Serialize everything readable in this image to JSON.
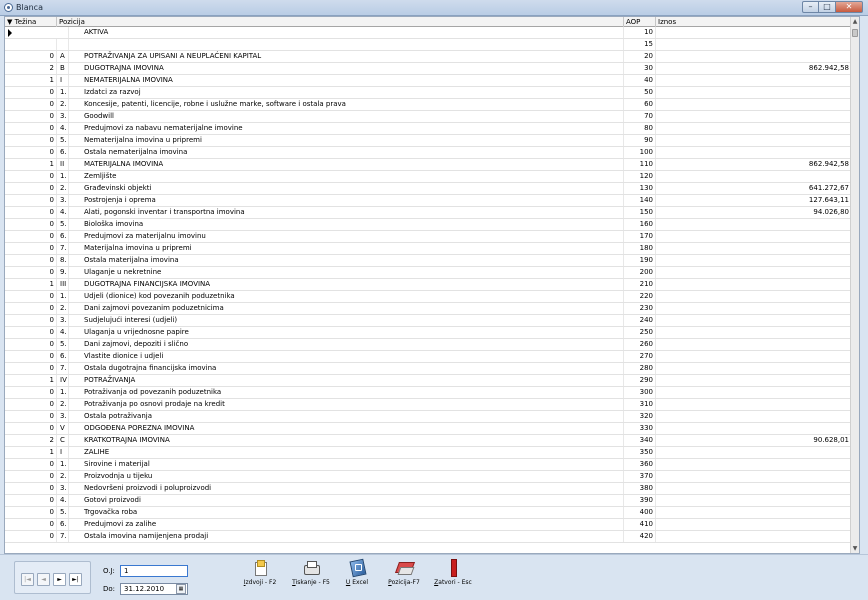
{
  "window": {
    "title": "Blanca",
    "minimize": "–",
    "maximize": "□",
    "close": "✕"
  },
  "grid": {
    "columns": {
      "tezina": "▼ Težina",
      "pozicija": "Pozicija",
      "aop": "AOP",
      "iznos": "Iznos"
    },
    "rows": [
      {
        "tez": "",
        "oz": "",
        "poz": "",
        "txt": "AKTIVA",
        "aop": "10",
        "iz": ""
      },
      {
        "tez": "",
        "oz": "",
        "poz": "",
        "txt": "",
        "aop": "15",
        "iz": ""
      },
      {
        "tez": "0",
        "oz": "A",
        "poz": "",
        "txt": "POTRAŽIVANJA ZA UPISANI A NEUPLAĆENI KAPITAL",
        "aop": "20",
        "iz": ""
      },
      {
        "tez": "2",
        "oz": "B",
        "poz": "",
        "txt": "DUGOTRAJNA IMOVINA",
        "aop": "30",
        "iz": "862.942,58"
      },
      {
        "tez": "1",
        "oz": "I",
        "poz": "",
        "txt": "NEMATERIJALNA IMOVINA",
        "aop": "40",
        "iz": ""
      },
      {
        "tez": "0",
        "oz": "1.",
        "poz": "",
        "txt": "Izdatci za razvoj",
        "aop": "50",
        "iz": ""
      },
      {
        "tez": "0",
        "oz": "2.",
        "poz": "",
        "txt": "Koncesije, patenti, licencije, robne i uslužne marke, software i ostala prava",
        "aop": "60",
        "iz": ""
      },
      {
        "tez": "0",
        "oz": "3.",
        "poz": "",
        "txt": "Goodwill",
        "aop": "70",
        "iz": ""
      },
      {
        "tez": "0",
        "oz": "4.",
        "poz": "",
        "txt": "Predujmovi za nabavu nematerijalne imovine",
        "aop": "80",
        "iz": ""
      },
      {
        "tez": "0",
        "oz": "5.",
        "poz": "",
        "txt": "Nematerijalna imovina u pripremi",
        "aop": "90",
        "iz": ""
      },
      {
        "tez": "0",
        "oz": "6.",
        "poz": "",
        "txt": "Ostala nematerijalna imovina",
        "aop": "100",
        "iz": ""
      },
      {
        "tez": "1",
        "oz": "II",
        "poz": "",
        "txt": "MATERIJALNA IMOVINA",
        "aop": "110",
        "iz": "862.942,58"
      },
      {
        "tez": "0",
        "oz": "1.",
        "poz": "",
        "txt": "Zemljište",
        "aop": "120",
        "iz": ""
      },
      {
        "tez": "0",
        "oz": "2.",
        "poz": "",
        "txt": "Građevinski objekti",
        "aop": "130",
        "iz": "641.272,67"
      },
      {
        "tez": "0",
        "oz": "3.",
        "poz": "",
        "txt": "Postrojenja i oprema",
        "aop": "140",
        "iz": "127.643,11"
      },
      {
        "tez": "0",
        "oz": "4.",
        "poz": "",
        "txt": "Alati, pogonski inventar i transportna imovina",
        "aop": "150",
        "iz": "94.026,80"
      },
      {
        "tez": "0",
        "oz": "5.",
        "poz": "",
        "txt": "Biološka imovina",
        "aop": "160",
        "iz": ""
      },
      {
        "tez": "0",
        "oz": "6.",
        "poz": "",
        "txt": "Predujmovi za materijalnu imovinu",
        "aop": "170",
        "iz": ""
      },
      {
        "tez": "0",
        "oz": "7.",
        "poz": "",
        "txt": "Materijalna imovina u pripremi",
        "aop": "180",
        "iz": ""
      },
      {
        "tez": "0",
        "oz": "8.",
        "poz": "",
        "txt": "Ostala materijalna imovina",
        "aop": "190",
        "iz": ""
      },
      {
        "tez": "0",
        "oz": "9.",
        "poz": "",
        "txt": "Ulaganje u nekretnine",
        "aop": "200",
        "iz": ""
      },
      {
        "tez": "1",
        "oz": "III",
        "poz": "",
        "txt": "DUGOTRAJNA FINANCIJSKA IMOVINA",
        "aop": "210",
        "iz": ""
      },
      {
        "tez": "0",
        "oz": "1.",
        "poz": "",
        "txt": "Udjeli (dionice) kod povezanih poduzetnika",
        "aop": "220",
        "iz": ""
      },
      {
        "tez": "0",
        "oz": "2.",
        "poz": "",
        "txt": "Dani zajmovi povezanim poduzetnicima",
        "aop": "230",
        "iz": ""
      },
      {
        "tez": "0",
        "oz": "3.",
        "poz": "",
        "txt": "Sudjelujući interesi (udjeli)",
        "aop": "240",
        "iz": ""
      },
      {
        "tez": "0",
        "oz": "4.",
        "poz": "",
        "txt": "Ulaganja u vrijednosne papire",
        "aop": "250",
        "iz": ""
      },
      {
        "tez": "0",
        "oz": "5.",
        "poz": "",
        "txt": "Dani zajmovi, depoziti i slično",
        "aop": "260",
        "iz": ""
      },
      {
        "tez": "0",
        "oz": "6.",
        "poz": "",
        "txt": "Vlastite dionice i udjeli",
        "aop": "270",
        "iz": ""
      },
      {
        "tez": "0",
        "oz": "7.",
        "poz": "",
        "txt": "Ostala dugotrajna financijska imovina",
        "aop": "280",
        "iz": ""
      },
      {
        "tez": "1",
        "oz": "IV",
        "poz": "",
        "txt": "POTRAŽIVANJA",
        "aop": "290",
        "iz": ""
      },
      {
        "tez": "0",
        "oz": "1.",
        "poz": "",
        "txt": "Potraživanja od povezanih poduzetnika",
        "aop": "300",
        "iz": ""
      },
      {
        "tez": "0",
        "oz": "2.",
        "poz": "",
        "txt": "Potraživanja po osnovi prodaje na kredit",
        "aop": "310",
        "iz": ""
      },
      {
        "tez": "0",
        "oz": "3.",
        "poz": "",
        "txt": "Ostala potraživanja",
        "aop": "320",
        "iz": ""
      },
      {
        "tez": "0",
        "oz": "V",
        "poz": "",
        "txt": "ODGOĐENA POREZNA IMOVINA",
        "aop": "330",
        "iz": ""
      },
      {
        "tez": "2",
        "oz": "C",
        "poz": "",
        "txt": "KRATKOTRAJNA IMOVINA",
        "aop": "340",
        "iz": "90.628,01"
      },
      {
        "tez": "1",
        "oz": "I",
        "poz": "",
        "txt": "ZALIHE",
        "aop": "350",
        "iz": ""
      },
      {
        "tez": "0",
        "oz": "1.",
        "poz": "",
        "txt": "Sirovine i materijal",
        "aop": "360",
        "iz": ""
      },
      {
        "tez": "0",
        "oz": "2.",
        "poz": "",
        "txt": "Proizvodnja u tijeku",
        "aop": "370",
        "iz": ""
      },
      {
        "tez": "0",
        "oz": "3.",
        "poz": "",
        "txt": "Nedovršeni proizvodi i poluproizvodi",
        "aop": "380",
        "iz": ""
      },
      {
        "tez": "0",
        "oz": "4.",
        "poz": "",
        "txt": "Gotovi proizvodi",
        "aop": "390",
        "iz": ""
      },
      {
        "tez": "0",
        "oz": "5.",
        "poz": "",
        "txt": "Trgovačka roba",
        "aop": "400",
        "iz": ""
      },
      {
        "tez": "0",
        "oz": "6.",
        "poz": "",
        "txt": "Predujmovi za zalihe",
        "aop": "410",
        "iz": ""
      },
      {
        "tez": "0",
        "oz": "7.",
        "poz": "",
        "txt": "Ostala imovina namijenjena prodaji",
        "aop": "420",
        "iz": ""
      }
    ]
  },
  "footer": {
    "nav": {
      "first": "|◄",
      "prev": "◄",
      "next": "►",
      "last": "►|"
    },
    "oj_label": "O.J:",
    "oj_value": "1",
    "do_label": "Do:",
    "do_value": "31.12.2010",
    "calendar": "▦",
    "actions": {
      "izdvoji_key": "I",
      "izdvoji_rest": "zdvoji - F2",
      "tiskanje_key": "T",
      "tiskanje_rest": "iskanje - F5",
      "excel_key": "U",
      "excel_rest": " Excel",
      "pozicija_key": "P",
      "pozicija_rest": "ozicija-F7",
      "zatvori_key": "Z",
      "zatvori_rest": "atvori - Esc"
    }
  }
}
